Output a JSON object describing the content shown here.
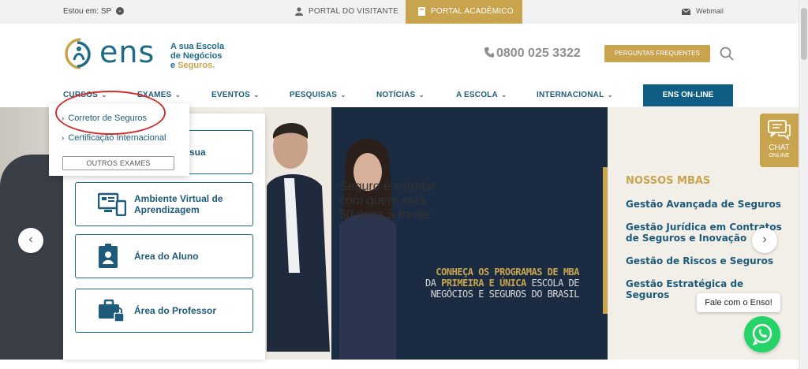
{
  "topbar": {
    "location_label": "Estou em:",
    "location_value": "SP",
    "visitor_portal": "PORTAL DO VISITANTE",
    "academic_portal": "PORTAL ACADÊMICO",
    "webmail": "Webmail"
  },
  "header": {
    "logo_text": "ens",
    "tagline_1": "A sua Escola",
    "tagline_2": "de Negócios",
    "tagline_3a": "e ",
    "tagline_3b": "Seguros.",
    "phone": "0800 025 3322",
    "faq_button": "PERGUNTAS FREQUENTES"
  },
  "nav": {
    "items": [
      "CURSOS",
      "EXAMES",
      "EVENTOS",
      "PESQUISAS",
      "NOTÍCIAS",
      "A ESCOLA",
      "INTERNACIONAL"
    ],
    "online_button": "ENS ON-LINE"
  },
  "dropdown": {
    "options": [
      "Corretor de Seguros",
      "Certificação Internacional"
    ],
    "more_button": "OUTROS EXAMES"
  },
  "quick_access": {
    "cards": [
      {
        "label_1": "a sua",
        "label_2": ""
      },
      {
        "label_1": "Ambiente Virtual de",
        "label_2": "Aprendizagem"
      },
      {
        "label_1": "Área do Aluno",
        "label_2": ""
      },
      {
        "label_1": "Área do Professor",
        "label_2": ""
      }
    ]
  },
  "hero": {
    "headline_1": "Seguro é estudar",
    "headline_2": "com quem está",
    "headline_3": "50 anos à frente",
    "sub_1a": "CONHEÇA OS PROGRAMAS DE MBA",
    "sub_2a": "DA ",
    "sub_2b": "PRIMEIRA E ÚNICA",
    "sub_2c": " ESCOLA DE",
    "sub_3": "NEGÓCIOS E SEGUROS DO BRASIL",
    "mba_title": "NOSSOS MBAS",
    "mba_items": [
      "Gestão Avançada de Seguros",
      "Gestão Jurídica em Contratos de Seguros e Inovação",
      "Gestão de Riscos e Seguros",
      "Gestão Estratégica de Seguros"
    ]
  },
  "chat": {
    "tab_label": "CHAT",
    "tab_sub": "ONLINE",
    "bubble": "Fale com o Enso!"
  },
  "colors": {
    "gold": "#c8a44e",
    "navy": "#1e5b7a",
    "online_blue": "#0e5e85",
    "hero_panel": "#1b2c42",
    "whatsapp": "#25d366"
  }
}
